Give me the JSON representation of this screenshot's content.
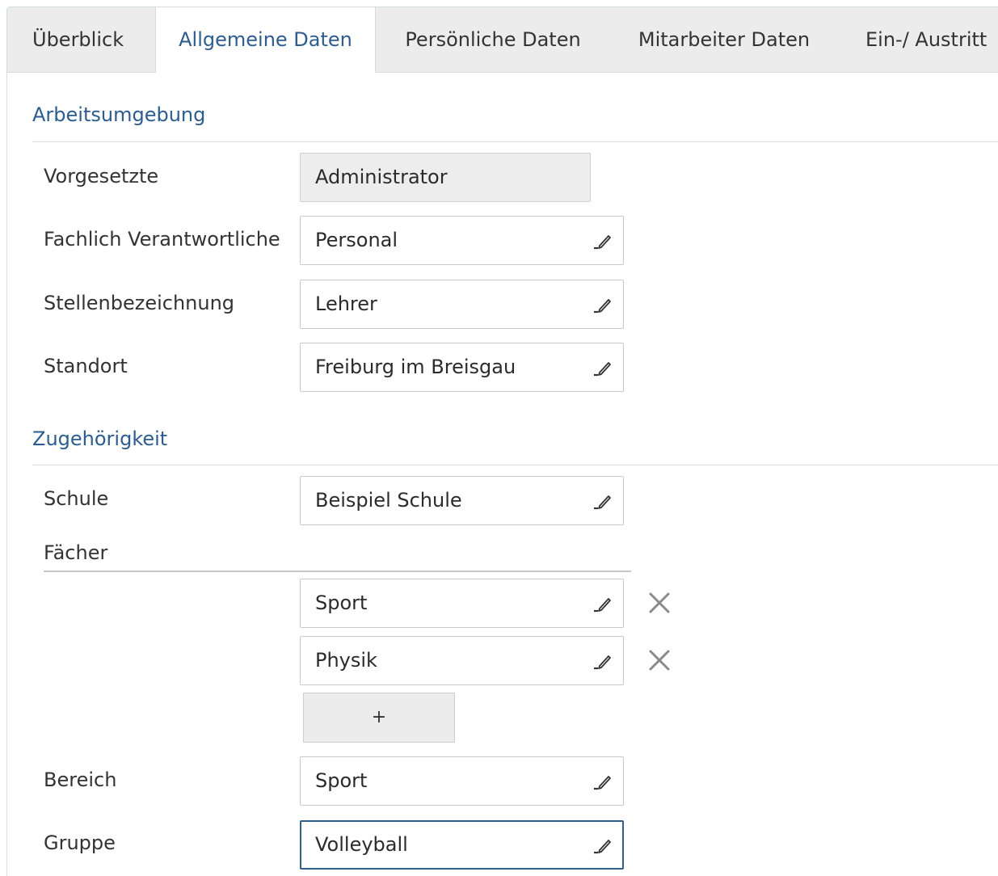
{
  "tabs": [
    {
      "label": "Überblick"
    },
    {
      "label": "Allgemeine Daten"
    },
    {
      "label": "Persönliche Daten"
    },
    {
      "label": "Mitarbeiter Daten"
    },
    {
      "label": "Ein-/ Austritt"
    }
  ],
  "active_tab": "Allgemeine Daten",
  "sections": {
    "arbeitsumgebung": {
      "title": "Arbeitsumgebung",
      "vorgesetzte": {
        "label": "Vorgesetzte",
        "value": "Administrator"
      },
      "fachlich": {
        "label": "Fachlich Verantwortliche",
        "value": "Personal"
      },
      "stelle": {
        "label": "Stellenbezeichnung",
        "value": "Lehrer"
      },
      "standort": {
        "label": "Standort",
        "value": "Freiburg im Breisgau"
      }
    },
    "zugehoerigkeit": {
      "title": "Zugehörigkeit",
      "schule": {
        "label": "Schule",
        "value": "Beispiel Schule"
      },
      "faecher": {
        "label": "Fächer",
        "items": [
          {
            "value": "Sport"
          },
          {
            "value": "Physik"
          }
        ],
        "add_label": "+"
      },
      "bereich": {
        "label": "Bereich",
        "value": "Sport"
      },
      "gruppe": {
        "label": "Gruppe",
        "value": "Volleyball"
      }
    }
  },
  "icons": {
    "edit": "pencil-icon",
    "remove": "close-icon"
  },
  "colors": {
    "accent": "#2a5d95",
    "tab_bg": "#ececec",
    "readonly_bg": "#ededed",
    "focus_border": "#2f5f90"
  }
}
